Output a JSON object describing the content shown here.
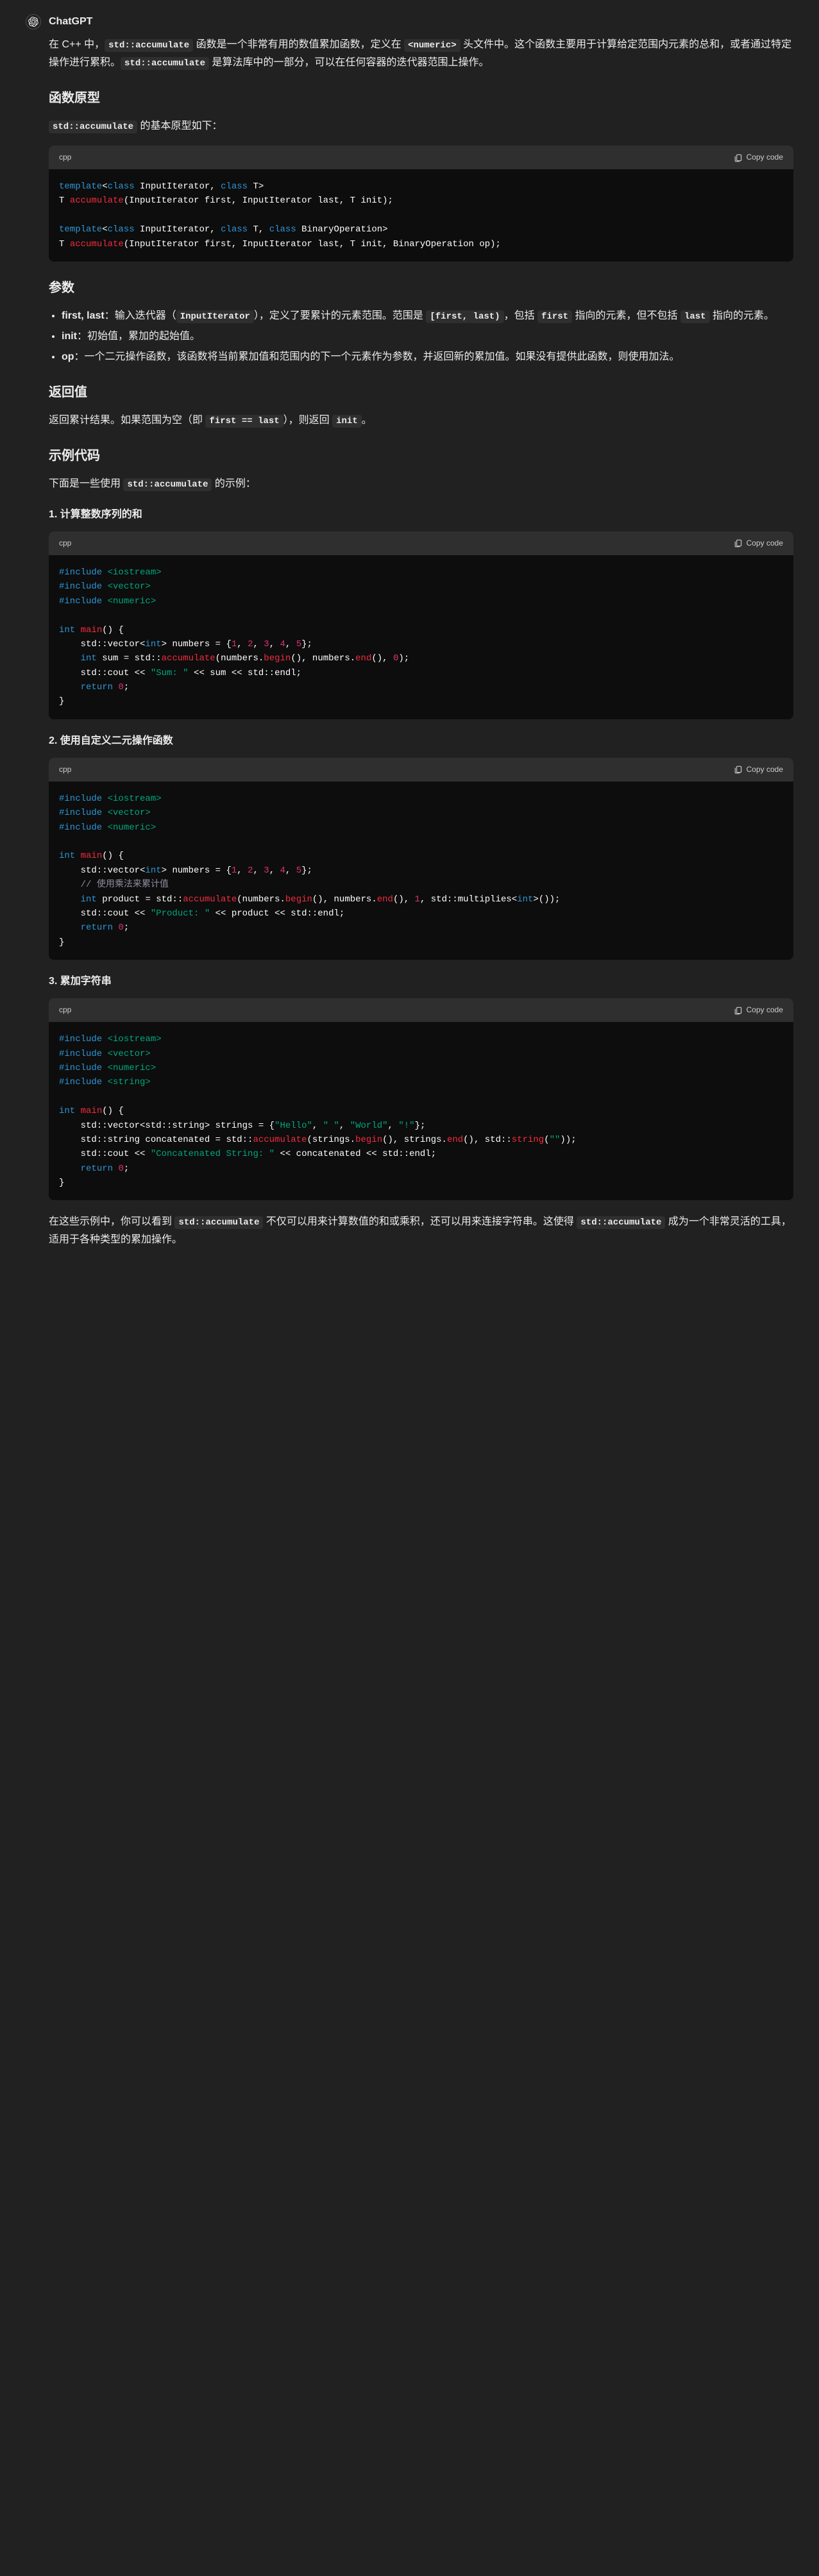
{
  "author": "ChatGPT",
  "intro": {
    "p1_pre": "在 C++ 中，",
    "p1_code1": "std::accumulate",
    "p1_mid1": " 函数是一个非常有用的数值累加函数，定义在 ",
    "p1_code2": "<numeric>",
    "p1_mid2": " 头文件中。这个函数主要用于计算给定范围内元素的总和，或者通过特定操作进行累积。",
    "p1_code3": "std::accumulate",
    "p1_end": " 是算法库中的一部分，可以在任何容器的迭代器范围上操作。"
  },
  "h_proto": "函数原型",
  "proto_p_pre": "",
  "proto_code": "std::accumulate",
  "proto_p_post": " 的基本原型如下：",
  "code_lang": "cpp",
  "copy_label": "Copy code",
  "h_params": "参数",
  "params": {
    "first_last_b": "first, last",
    "first_last_t1": "：输入迭代器（",
    "first_last_c1": "InputIterator",
    "first_last_t2": "），定义了要累计的元素范围。范围是 ",
    "first_last_c2": "[first, last)",
    "first_last_t3": "，包括 ",
    "first_last_c3": "first",
    "first_last_t4": " 指向的元素，但不包括 ",
    "first_last_c4": "last",
    "first_last_t5": " 指向的元素。",
    "init_b": "init",
    "init_t": "：初始值，累加的起始值。",
    "op_b": "op",
    "op_t": "：一个二元操作函数，该函数将当前累加值和范围内的下一个元素作为参数，并返回新的累加值。如果没有提供此函数，则使用加法。"
  },
  "h_return": "返回值",
  "return_p_t1": "返回累计结果。如果范围为空（即 ",
  "return_p_c1": "first == last",
  "return_p_t2": "），则返回 ",
  "return_p_c2": "init",
  "return_p_t3": "。",
  "h_examples": "示例代码",
  "examples_p_t1": "下面是一些使用 ",
  "examples_p_c1": "std::accumulate",
  "examples_p_t2": " 的示例：",
  "ex1_h": "1. 计算整数序列的和",
  "ex2_h": "2. 使用自定义二元操作函数",
  "ex3_h": "3. 累加字符串",
  "outro": {
    "t1": "在这些示例中，你可以看到 ",
    "c1": "std::accumulate",
    "t2": " 不仅可以用来计算数值的和或乘积，还可以用来连接字符串。这使得 ",
    "c2": "std::accumulate",
    "t3": " 成为一个非常灵活的工具，适用于各种类型的累加操作。"
  }
}
